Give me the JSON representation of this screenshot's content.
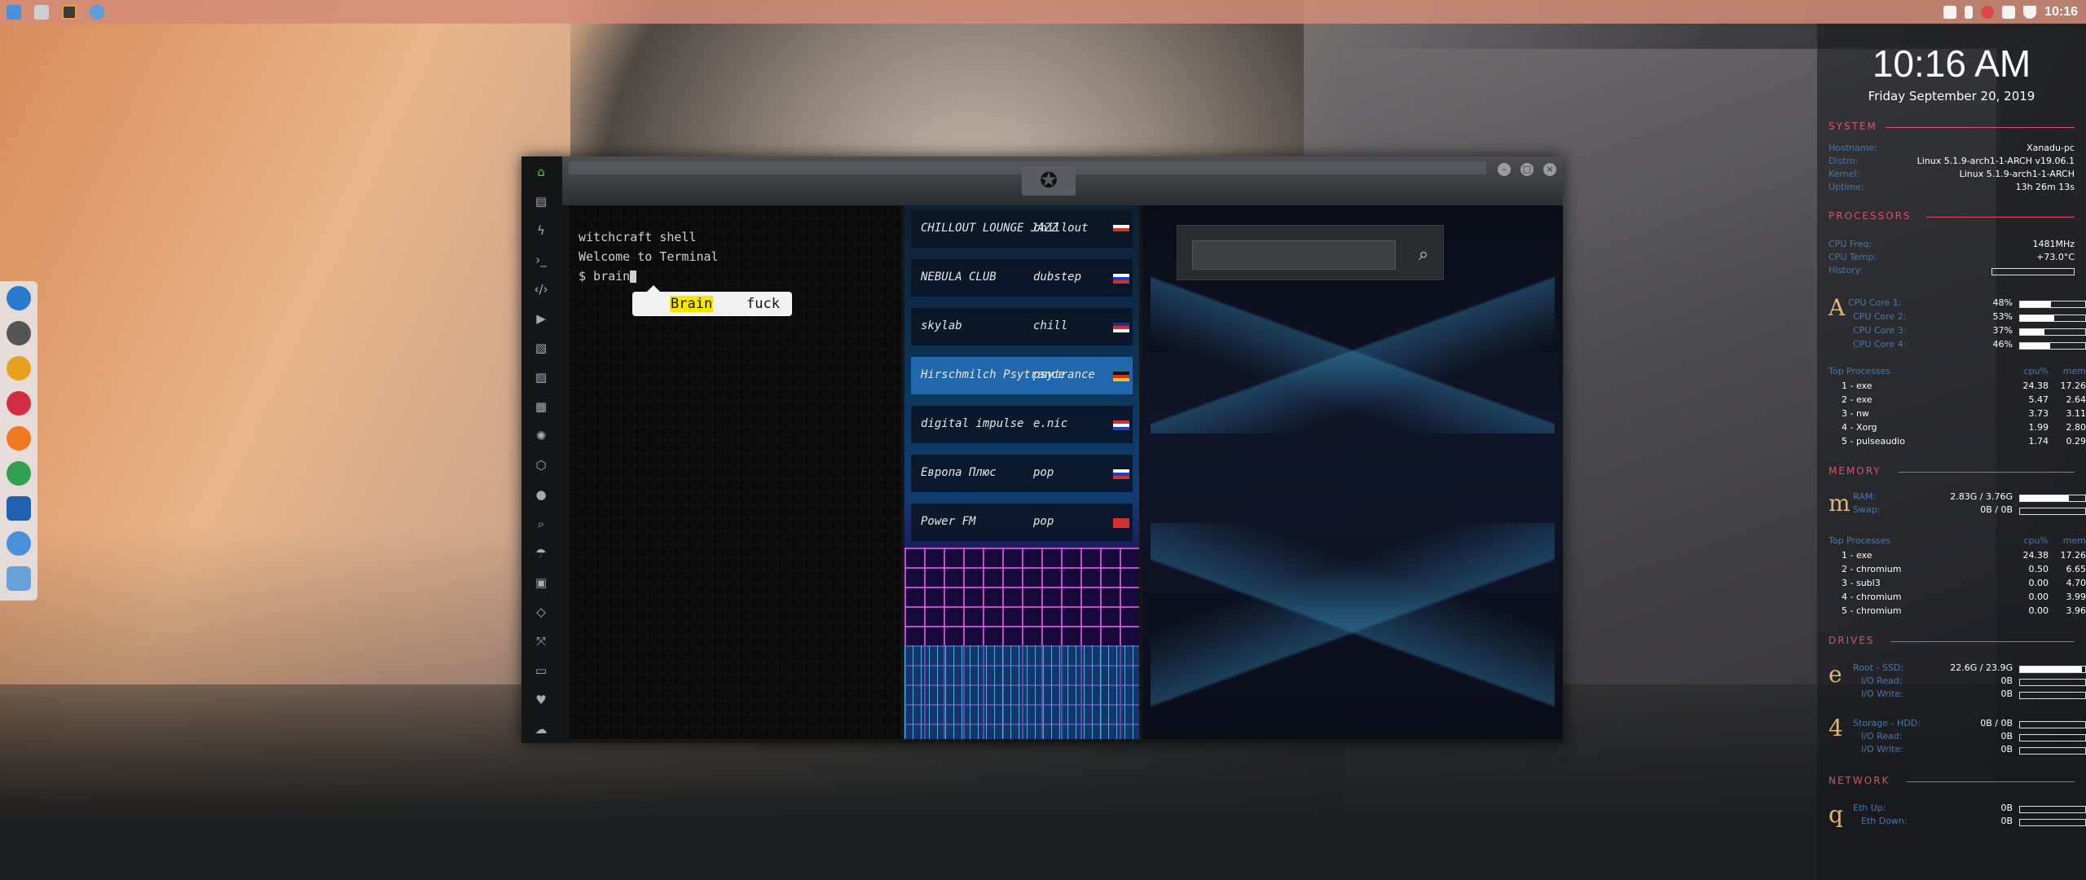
{
  "top_panel": {
    "clock": "10:16",
    "launchers": [
      "file-manager-icon",
      "terminal-icon",
      "sublime-text-icon",
      "chromium-icon"
    ]
  },
  "dock": {
    "items": [
      "files-icon",
      "money-icon",
      "settings-icon",
      "vivaldi-icon",
      "stacer-icon",
      "system-monitor-icon",
      "screenshot-icon",
      "chromium-icon",
      "web-icon"
    ]
  },
  "conky": {
    "time": "10:16 AM",
    "date": "Friday September 20, 2019",
    "system": {
      "title": "SYSTEM",
      "rows": [
        {
          "k": "Hostname:",
          "v": "Xanadu-pc"
        },
        {
          "k": "Distro:",
          "v": "Linux 5.1.9-arch1-1-ARCH v19.06.1"
        },
        {
          "k": "Kernel:",
          "v": "Linux 5.1.9-arch1-1-ARCH"
        },
        {
          "k": "Uptime:",
          "v": "13h 26m 13s"
        }
      ]
    },
    "processors": {
      "title": "PROCESSORS",
      "freq_label": "CPU Freq:",
      "freq": "1481MHz",
      "temp_label": "CPU Temp:",
      "temp": "+73.0°C",
      "history_label": "History:",
      "letter": "A",
      "cores": [
        {
          "label": "CPU Core 1:",
          "value": "48%",
          "fraction": 0.48
        },
        {
          "label": "CPU Core 2:",
          "value": "53%",
          "fraction": 0.53
        },
        {
          "label": "CPU Core 3:",
          "value": "37%",
          "fraction": 0.37
        },
        {
          "label": "CPU Core 4:",
          "value": "46%",
          "fraction": 0.46
        }
      ],
      "top_title": "Top Processes",
      "col_cpu": "cpu%",
      "col_mem": "mem",
      "top": [
        {
          "n": "1 - exe",
          "cpu": "24.38",
          "mem": "17.26"
        },
        {
          "n": "2 - exe",
          "cpu": "5.47",
          "mem": "2.64"
        },
        {
          "n": "3 - nw",
          "cpu": "3.73",
          "mem": "3.11"
        },
        {
          "n": "4 - Xorg",
          "cpu": "1.99",
          "mem": "2.80"
        },
        {
          "n": "5 - pulseaudio",
          "cpu": "1.74",
          "mem": "0.29"
        }
      ]
    },
    "memory": {
      "title": "MEMORY",
      "letter": "m",
      "ram_label": "RAM:",
      "ram": "2.83G / 3.76G",
      "ram_fraction": 0.75,
      "swap_label": "Swap:",
      "swap": "0B / 0B",
      "swap_fraction": 0.0,
      "top_title": "Top Processes",
      "col_cpu": "cpu%",
      "col_mem": "mem",
      "top": [
        {
          "n": "1 - exe",
          "cpu": "24.38",
          "mem": "17.26"
        },
        {
          "n": "2 - chromium",
          "cpu": "0.50",
          "mem": "6.65"
        },
        {
          "n": "3 - subl3",
          "cpu": "0.00",
          "mem": "4.70"
        },
        {
          "n": "4 - chromium",
          "cpu": "0.00",
          "mem": "3.99"
        },
        {
          "n": "5 - chromium",
          "cpu": "0.00",
          "mem": "3.96"
        }
      ]
    },
    "drives": {
      "title": "DRIVES",
      "letter1": "e",
      "root_label": "Root - SSD:",
      "root": "22.6G / 23.9G",
      "root_fraction": 0.95,
      "io_read_label": "I/O Read:",
      "io_read": "0B",
      "io_write_label": "I/O Write:",
      "io_write": "0B",
      "letter2": "4",
      "hdd_label": "Storage - HDD:",
      "hdd": "0B / 0B",
      "io_read2": "0B",
      "io_write2": "0B"
    },
    "network": {
      "title": "NETWORK",
      "letter": "q",
      "up_label": "Eth Up:",
      "up": "0B",
      "down_label": "Eth Down:",
      "down": "0B"
    }
  },
  "app": {
    "terminal": {
      "line1": "witchcraft shell",
      "line2": "Welcome to Terminal",
      "prompt": "$ brain",
      "suggest_1": "Brain",
      "suggest_2": "fuck"
    },
    "stations": [
      {
        "name": "CHILLOUT LOUNGE JAZZ",
        "genre": "chillout",
        "flag": [
          "#ffffff",
          "#d03030"
        ]
      },
      {
        "name": "NEBULA CLUB",
        "genre": "dubstep",
        "flag": [
          "#ffffff",
          "#2040c0",
          "#d03030"
        ]
      },
      {
        "name": "skylab",
        "genre": "chill",
        "flag": [
          "#203080",
          "#d03030",
          "#ffffff"
        ]
      },
      {
        "name": "Hirschmilch Psytrance",
        "genre": "psytrance",
        "flag": [
          "#111111",
          "#d03030",
          "#f0c020"
        ]
      },
      {
        "name": "digital impulse",
        "genre": "e.nic",
        "flag": [
          "#d03030",
          "#ffffff",
          "#2040c0"
        ]
      },
      {
        "name": "Европа Плюс",
        "genre": "pop",
        "flag": [
          "#ffffff",
          "#2040c0",
          "#d03030"
        ]
      },
      {
        "name": "Power FM",
        "genre": "pop",
        "flag": [
          "#d03030",
          "#d03030",
          "#d03030"
        ]
      }
    ],
    "active_station": 3,
    "search_placeholder": ""
  }
}
